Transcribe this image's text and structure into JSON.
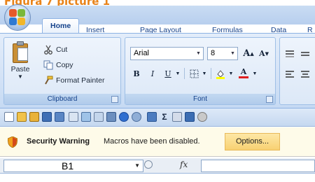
{
  "caption": "Figura 7 picture 1",
  "ribbon": {
    "tabs": [
      {
        "label": "Home",
        "active": true
      },
      {
        "label": "Insert"
      },
      {
        "label": "Page Layout"
      },
      {
        "label": "Formulas"
      },
      {
        "label": "Data"
      },
      {
        "label": "R"
      }
    ],
    "clipboard": {
      "paste_label": "Paste",
      "cut_label": "Cut",
      "copy_label": "Copy",
      "format_painter_label": "Format Painter",
      "group_label": "Clipboard"
    },
    "font": {
      "font_name": "Arial",
      "font_size": "8",
      "grow_label": "A",
      "shrink_label": "A",
      "bold_label": "B",
      "italic_label": "I",
      "underline_label": "U",
      "font_color_label": "A",
      "group_label": "Font"
    }
  },
  "security_bar": {
    "title": "Security Warning",
    "message": "Macros have been disabled.",
    "options_label": "Options..."
  },
  "formula_bar": {
    "name_box_value": "B1",
    "fx_label": "fx"
  },
  "colors": {
    "accent_orange": "#e8831a",
    "ribbon_blue": "#15428b",
    "warning_bg": "#fefbe9",
    "options_bg": "#f8d172"
  }
}
